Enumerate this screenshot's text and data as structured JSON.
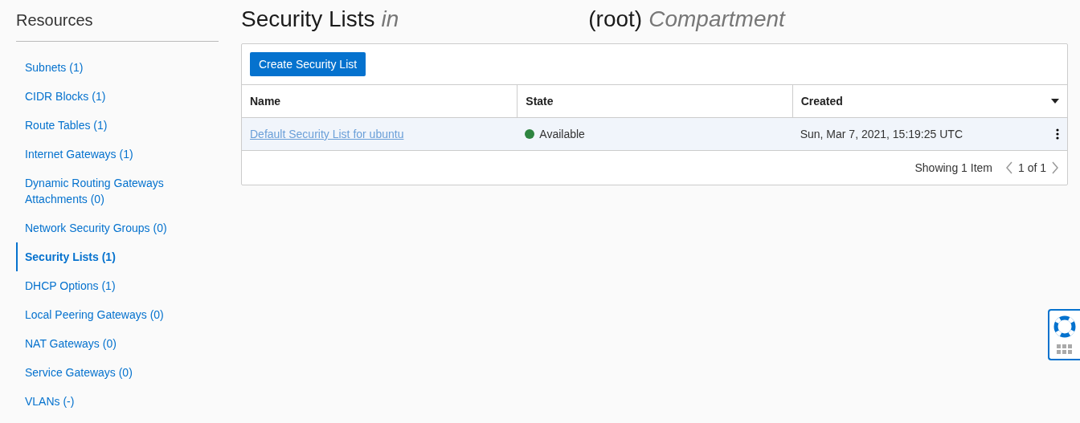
{
  "sidebar": {
    "title": "Resources",
    "items": [
      {
        "label": "Subnets (1)",
        "selected": false
      },
      {
        "label": "CIDR Blocks (1)",
        "selected": false
      },
      {
        "label": "Route Tables (1)",
        "selected": false
      },
      {
        "label": "Internet Gateways (1)",
        "selected": false
      },
      {
        "label": "Dynamic Routing Gateways Attachments (0)",
        "selected": false
      },
      {
        "label": "Network Security Groups (0)",
        "selected": false
      },
      {
        "label": "Security Lists (1)",
        "selected": true
      },
      {
        "label": "DHCP Options (1)",
        "selected": false
      },
      {
        "label": "Local Peering Gateways (0)",
        "selected": false
      },
      {
        "label": "NAT Gateways (0)",
        "selected": false
      },
      {
        "label": "Service Gateways (0)",
        "selected": false
      },
      {
        "label": "VLANs (-)",
        "selected": false
      }
    ]
  },
  "header": {
    "title": "Security Lists",
    "scope": "in",
    "compartment": "(root)",
    "suffix": "Compartment"
  },
  "toolbar": {
    "create_button": "Create Security List"
  },
  "table": {
    "columns": [
      {
        "label": "Name",
        "sorted": false
      },
      {
        "label": "State",
        "sorted": false
      },
      {
        "label": "Created",
        "sorted": true
      }
    ],
    "rows": [
      {
        "name": "Default Security List for ubuntu",
        "state": "Available",
        "color": "#2e8540",
        "created": "Sun, Mar 7, 2021, 15:19:25 UTC",
        "selected": true
      }
    ]
  },
  "pagination": {
    "summary": "Showing 1 Item",
    "page": "1 of 1"
  }
}
